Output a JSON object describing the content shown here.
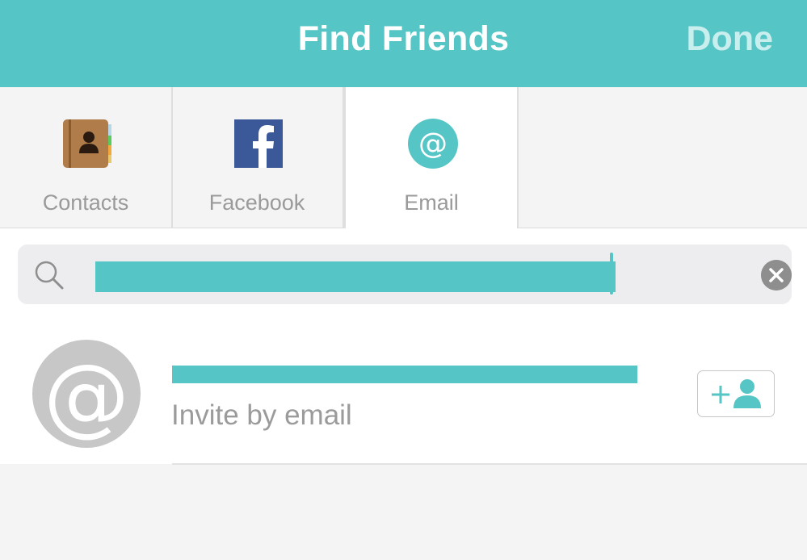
{
  "header": {
    "title": "Find Friends",
    "done_label": "Done"
  },
  "tabs": [
    {
      "label": "Contacts",
      "icon": "contacts-book-icon"
    },
    {
      "label": "Facebook",
      "icon": "facebook-icon"
    },
    {
      "label": "Email",
      "icon": "at-sign-icon",
      "active": true
    }
  ],
  "search": {
    "icon": "search-icon",
    "clear_icon": "clear-icon"
  },
  "result": {
    "avatar_glyph": "@",
    "subtitle": "Invite by email",
    "action_icon": "add-friend-icon"
  },
  "colors": {
    "accent": "#56c5c5",
    "facebook": "#3b5998"
  }
}
